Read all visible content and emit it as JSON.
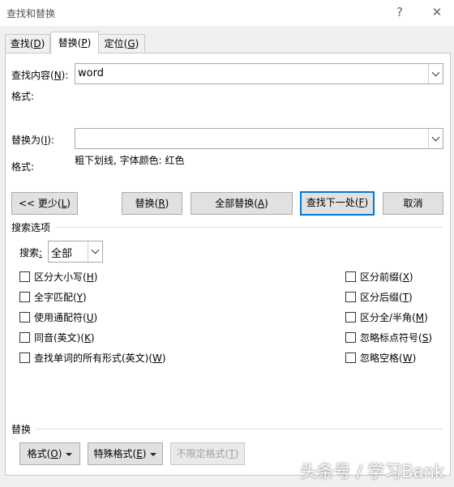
{
  "window": {
    "title": "查找和替换",
    "help_label": "?",
    "close_label": "✕"
  },
  "tabs": [
    {
      "label": "查找(",
      "key": "D",
      "end": ")"
    },
    {
      "label": "替换(",
      "key": "P",
      "end": ")"
    },
    {
      "label": "定位(",
      "key": "G",
      "end": ")"
    }
  ],
  "find": {
    "label_pre": "查找内容(",
    "label_key": "N",
    "label_post": "):",
    "value": "word",
    "format_label": "格式:"
  },
  "replace": {
    "label_pre": "替换为(",
    "label_key": "I",
    "label_post": "):",
    "value": "",
    "format_label": "格式:",
    "format_value": "粗下划线, 字体颜色: 红色"
  },
  "buttons": {
    "less": {
      "pre": "<< 更少(",
      "key": "L",
      "post": ")"
    },
    "replace": {
      "pre": "替换(",
      "key": "R",
      "post": ")"
    },
    "replace_all": {
      "pre": "全部替换(",
      "key": "A",
      "post": ")"
    },
    "find_next": {
      "pre": "查找下一处(",
      "key": "F",
      "post": ")"
    },
    "cancel": "取消"
  },
  "search_options": {
    "title": "搜索选项",
    "search_label_pre": "搜索",
    "search_label_key": ":",
    "search_value": "全部",
    "left": [
      {
        "pre": "区分大小写(",
        "key": "H",
        "post": ")"
      },
      {
        "pre": "全字匹配(",
        "key": "Y",
        "post": ")"
      },
      {
        "pre": "使用通配符(",
        "key": "U",
        "post": ")"
      },
      {
        "pre": "同音(英文)(",
        "key": "K",
        "post": ")"
      },
      {
        "pre": "查找单词的所有形式(英文)(",
        "key": "W",
        "post": ")"
      }
    ],
    "right": [
      {
        "pre": "区分前缀(",
        "key": "X",
        "post": ")"
      },
      {
        "pre": "区分后缀(",
        "key": "T",
        "post": ")"
      },
      {
        "pre": "区分全/半角(",
        "key": "M",
        "post": ")"
      },
      {
        "pre": "忽略标点符号(",
        "key": "S",
        "post": ")"
      },
      {
        "pre": "忽略空格(",
        "key": "W",
        "post": ")"
      }
    ]
  },
  "replace_section": {
    "title": "替换",
    "format_btn": {
      "pre": "格式(",
      "key": "O",
      "post": ")"
    },
    "special_btn": {
      "pre": "特殊格式(",
      "key": "E",
      "post": ")"
    },
    "no_format_btn": {
      "pre": "不限定格式(",
      "key": "T",
      "post": ")"
    }
  },
  "watermark": "头条号 / 学习Bank"
}
